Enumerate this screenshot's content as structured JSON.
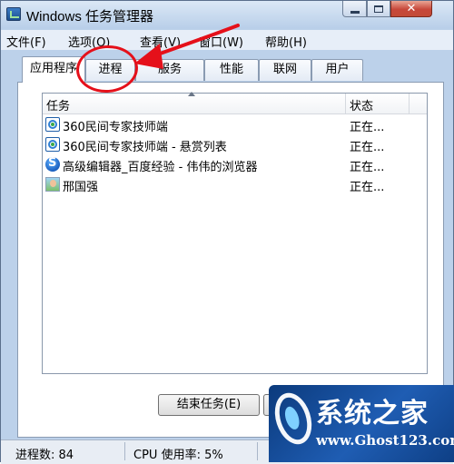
{
  "window": {
    "title": "Windows 任务管理器",
    "close_glyph": "✕"
  },
  "menu": {
    "items": [
      "文件(F)",
      "选项(O)",
      "查看(V)",
      "窗口(W)",
      "帮助(H)"
    ]
  },
  "tabs": [
    {
      "label": "应用程序",
      "active": true
    },
    {
      "label": "进程",
      "active": false
    },
    {
      "label": "服务",
      "active": false
    },
    {
      "label": "性能",
      "active": false
    },
    {
      "label": "联网",
      "active": false
    },
    {
      "label": "用户",
      "active": false
    }
  ],
  "task_list": {
    "columns": [
      "任务",
      "状态"
    ],
    "rows": [
      {
        "name": "360民间专家技师端",
        "status": "正在...",
        "icon": "360-icon"
      },
      {
        "name": "360民间专家技师端 - 悬赏列表",
        "status": "正在...",
        "icon": "360-icon"
      },
      {
        "name": "高级编辑器_百度经验 - 伟伟的浏览器",
        "status": "正在...",
        "icon": "browser-icon"
      },
      {
        "name": "邢国强",
        "status": "正在...",
        "icon": "contact-photo-icon"
      }
    ]
  },
  "buttons": {
    "end_task": "结束任务(E)",
    "switch_to": "切"
  },
  "status_bar": {
    "process_count": "进程数: 84",
    "cpu_usage": "CPU 使用率: 5%"
  },
  "watermark": {
    "title": "系统之家",
    "url": "www.Ghost123.com"
  },
  "annotation": {
    "color": "#e5101a"
  }
}
